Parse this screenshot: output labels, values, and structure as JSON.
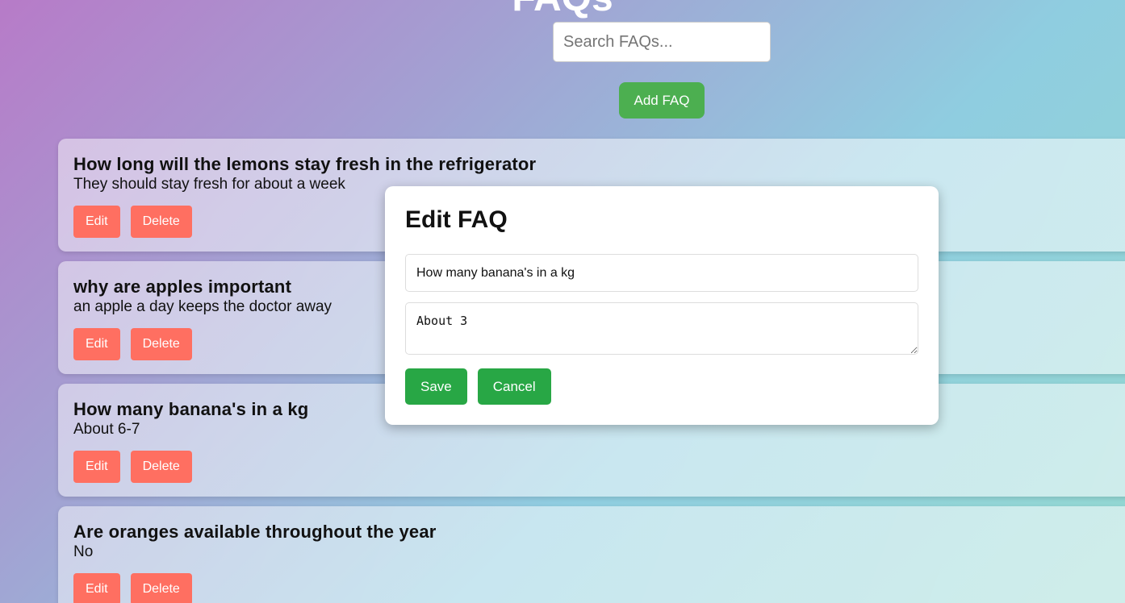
{
  "header": {
    "title": "FAQs",
    "search_placeholder": "Search FAQs...",
    "add_label": "Add FAQ"
  },
  "faqs": [
    {
      "question": "How long will the lemons stay fresh in the refrigerator",
      "answer": "They should stay fresh for about a week",
      "edit_label": "Edit",
      "delete_label": "Delete"
    },
    {
      "question": "why are apples important",
      "answer": "an apple a day keeps the doctor away",
      "edit_label": "Edit",
      "delete_label": "Delete"
    },
    {
      "question": "How many banana's in a kg",
      "answer": "About 6-7",
      "edit_label": "Edit",
      "delete_label": "Delete"
    },
    {
      "question": "Are oranges available throughout the year",
      "answer": "No",
      "edit_label": "Edit",
      "delete_label": "Delete"
    }
  ],
  "edit_modal": {
    "title": "Edit FAQ",
    "question_value": "How many banana's in a kg",
    "answer_value": "About 3",
    "save_label": "Save",
    "cancel_label": "Cancel"
  },
  "colors": {
    "add_button": "#4caf50",
    "card_button": "#ff6f61",
    "modal_button": "#28a745"
  }
}
